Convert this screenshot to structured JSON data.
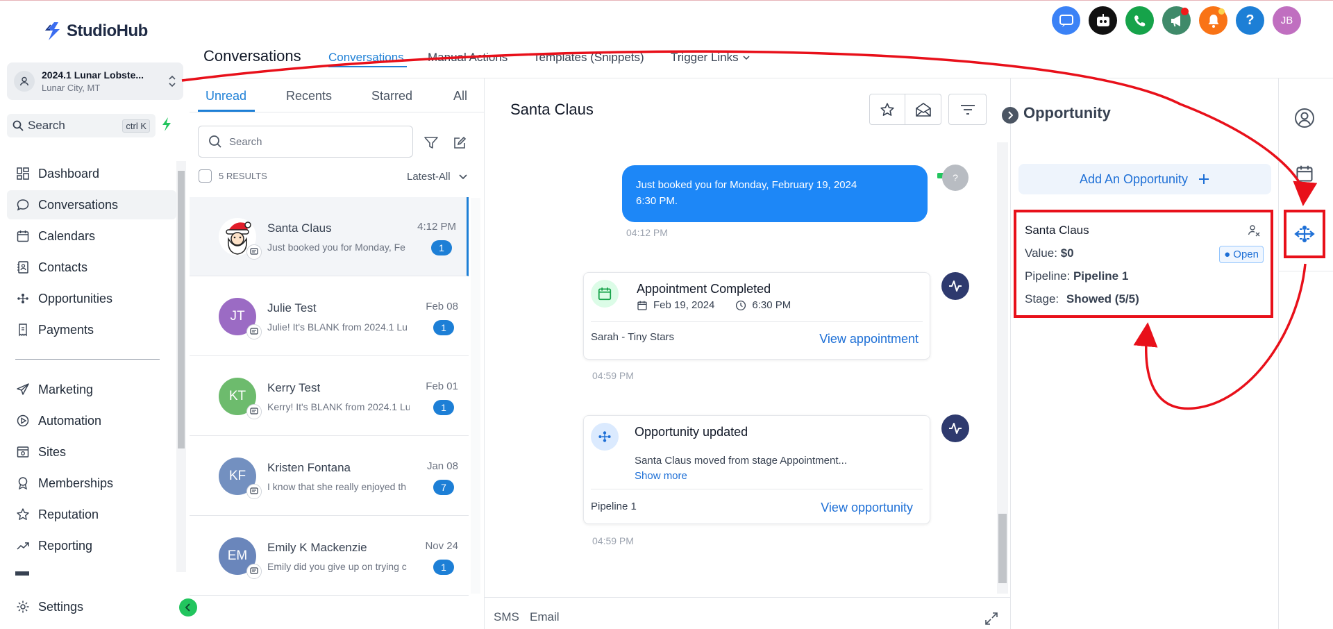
{
  "app": {
    "logo_text": "StudioHub"
  },
  "account": {
    "name": "2024.1 Lunar Lobste...",
    "location": "Lunar City, MT"
  },
  "sidebar_search": {
    "label": "Search",
    "shortcut": "ctrl K"
  },
  "nav_items": [
    {
      "label": "Dashboard",
      "icon": "dashboard-icon"
    },
    {
      "label": "Conversations",
      "icon": "chat-icon"
    },
    {
      "label": "Calendars",
      "icon": "calendar-icon"
    },
    {
      "label": "Contacts",
      "icon": "contacts-icon"
    },
    {
      "label": "Opportunities",
      "icon": "opportunities-icon"
    },
    {
      "label": "Payments",
      "icon": "payments-icon"
    },
    {
      "label": "Marketing",
      "icon": "send-icon"
    },
    {
      "label": "Automation",
      "icon": "automation-icon"
    },
    {
      "label": "Sites",
      "icon": "sites-icon"
    },
    {
      "label": "Memberships",
      "icon": "memberships-icon"
    },
    {
      "label": "Reputation",
      "icon": "star-icon"
    },
    {
      "label": "Reporting",
      "icon": "reporting-icon"
    },
    {
      "label": "Settings",
      "icon": "gear-icon"
    }
  ],
  "header": {
    "title": "Conversations",
    "tabs": [
      "Conversations",
      "Manual Actions",
      "Templates (Snippets)",
      "Trigger Links"
    ]
  },
  "top_icons": [
    {
      "name": "chat-widget-icon",
      "color": "#3b82f6"
    },
    {
      "name": "bot-icon",
      "color": "#111111"
    },
    {
      "name": "phone-icon",
      "color": "#16a34a"
    },
    {
      "name": "megaphone-icon",
      "color": "#3f8a6a"
    },
    {
      "name": "bell-icon",
      "color": "#f97316"
    },
    {
      "name": "help-icon",
      "color": "#1d7fd6"
    },
    {
      "name": "user-avatar",
      "color": "#c06fc0",
      "initials": "JB"
    }
  ],
  "list": {
    "tabs": [
      "Unread",
      "Recents",
      "Starred",
      "All"
    ],
    "search_placeholder": "Search",
    "results": "5 RESULTS",
    "sort": "Latest-All",
    "conversations": [
      {
        "name": "Santa Claus",
        "preview": "Just booked you for Monday, Fe",
        "time": "4:12 PM",
        "count": "1",
        "initials": "",
        "color": "#ffffff"
      },
      {
        "name": "Julie Test",
        "preview": "Julie! It's BLANK from 2024.1 Lu",
        "time": "Feb 08",
        "count": "1",
        "initials": "JT",
        "color": "#9b6bc4"
      },
      {
        "name": "Kerry Test",
        "preview": "Kerry! It's BLANK from 2024.1 Lu",
        "time": "Feb 01",
        "count": "1",
        "initials": "KT",
        "color": "#6dbb6d"
      },
      {
        "name": "Kristen Fontana",
        "preview": "I know that she really enjoyed th",
        "time": "Jan 08",
        "count": "7",
        "initials": "KF",
        "color": "#7390c0"
      },
      {
        "name": "Emily K Mackenzie",
        "preview": "Emily did you give up on trying c",
        "time": "Nov 24",
        "count": "1",
        "initials": "EM",
        "color": "#6a86bb"
      }
    ]
  },
  "chat": {
    "contact_name": "Santa Claus",
    "message": {
      "line1": "Just booked you for Monday, February 19, 2024",
      "line2": "6:30 PM.",
      "time": "04:12 PM",
      "avatar": "?"
    },
    "appointment": {
      "title": "Appointment Completed",
      "date": "Feb 19, 2024",
      "time": "6:30 PM",
      "calendar": "Sarah - Tiny Stars",
      "link": "View appointment",
      "stamp": "04:59 PM"
    },
    "opportunity_update": {
      "title": "Opportunity updated",
      "body": "Santa Claus moved from stage Appointment...",
      "show_more": "Show more",
      "pipeline": "Pipeline 1",
      "link": "View opportunity",
      "stamp": "04:59 PM"
    },
    "bottom_tabs": [
      "SMS",
      "Email"
    ]
  },
  "opportunity": {
    "title": "Opportunity",
    "add_label": "Add An Opportunity",
    "card": {
      "name": "Santa Claus",
      "value_label": "Value:",
      "value": "$0",
      "status": "Open",
      "pipeline_label": "Pipeline:",
      "pipeline": "Pipeline 1",
      "stage_label": "Stage:",
      "stage": "Showed (5/5)"
    }
  },
  "annotation_color": "#e8101a"
}
